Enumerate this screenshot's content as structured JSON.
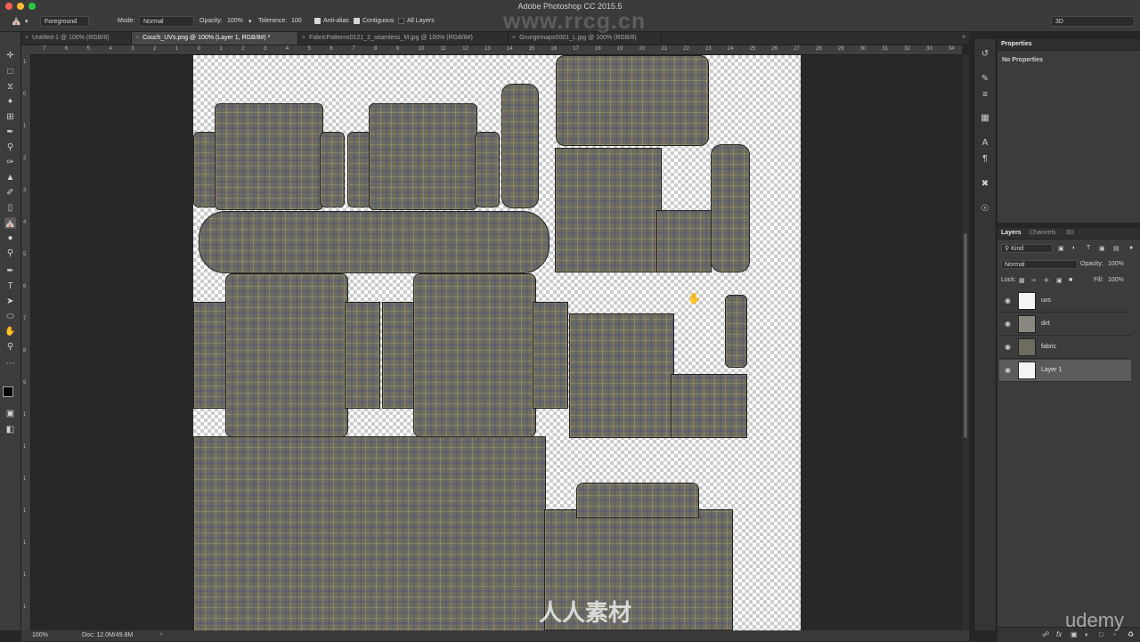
{
  "app": {
    "title": "Adobe Photoshop CC 2015.5"
  },
  "options_bar": {
    "tool_preset": "Foreground",
    "mode_label": "Mode:",
    "mode_value": "Normal",
    "opacity_label": "Opacity:",
    "opacity_value": "100%",
    "tolerance_label": "Tolerance:",
    "tolerance_value": "100",
    "anti_alias": "Anti-alias",
    "contiguous": "Contiguous",
    "all_layers": "All Layers",
    "workspace": "3D"
  },
  "tabs": [
    {
      "label": "Untitled-1 @ 100% (RGB/8)"
    },
    {
      "label": "Couch_UVs.png @ 100% (Layer 1, RGB/8#) *"
    },
    {
      "label": "FabricPatterns0121_2_seamless_M.jpg @ 100% (RGB/8#)"
    },
    {
      "label": "Grungemaps0001_L.jpg @ 100% (RGB/8)"
    }
  ],
  "ruler_top": [
    "7",
    "6",
    "5",
    "4",
    "3",
    "2",
    "1",
    "0",
    "1",
    "2",
    "3",
    "4",
    "5",
    "6",
    "7",
    "8",
    "9",
    "10",
    "11",
    "12",
    "13",
    "14",
    "15",
    "16",
    "17",
    "18",
    "19",
    "20",
    "21",
    "22",
    "23",
    "24",
    "25",
    "26",
    "27",
    "28",
    "29",
    "30",
    "31",
    "32",
    "33",
    "34"
  ],
  "ruler_left": [
    "1",
    "0",
    "1",
    "2",
    "3",
    "4",
    "5",
    "6",
    "7",
    "8",
    "9",
    "1",
    "1",
    "1",
    "1",
    "1",
    "1",
    "1"
  ],
  "status": {
    "zoom": "100%",
    "doc": "Doc: 12.0M/49.8M"
  },
  "properties": {
    "tab": "Properties",
    "empty_text": "No Properties"
  },
  "layers_panel": {
    "tabs": [
      "Layers",
      "Channels",
      "3D"
    ],
    "filter_kind": "Kind",
    "blend_mode": "Normal",
    "opacity_label": "Opacity:",
    "opacity_value": "100%",
    "lock_label": "Lock:",
    "fill_label": "Fill:",
    "fill_value": "100%",
    "layers": [
      {
        "name": "uvs",
        "selected": false
      },
      {
        "name": "dirt",
        "selected": false
      },
      {
        "name": "fabric",
        "selected": false
      },
      {
        "name": "Layer 1",
        "selected": true
      }
    ]
  },
  "watermarks": {
    "site": "www.rrcg.cn",
    "logo": "人人素材",
    "brand": "udemy"
  }
}
